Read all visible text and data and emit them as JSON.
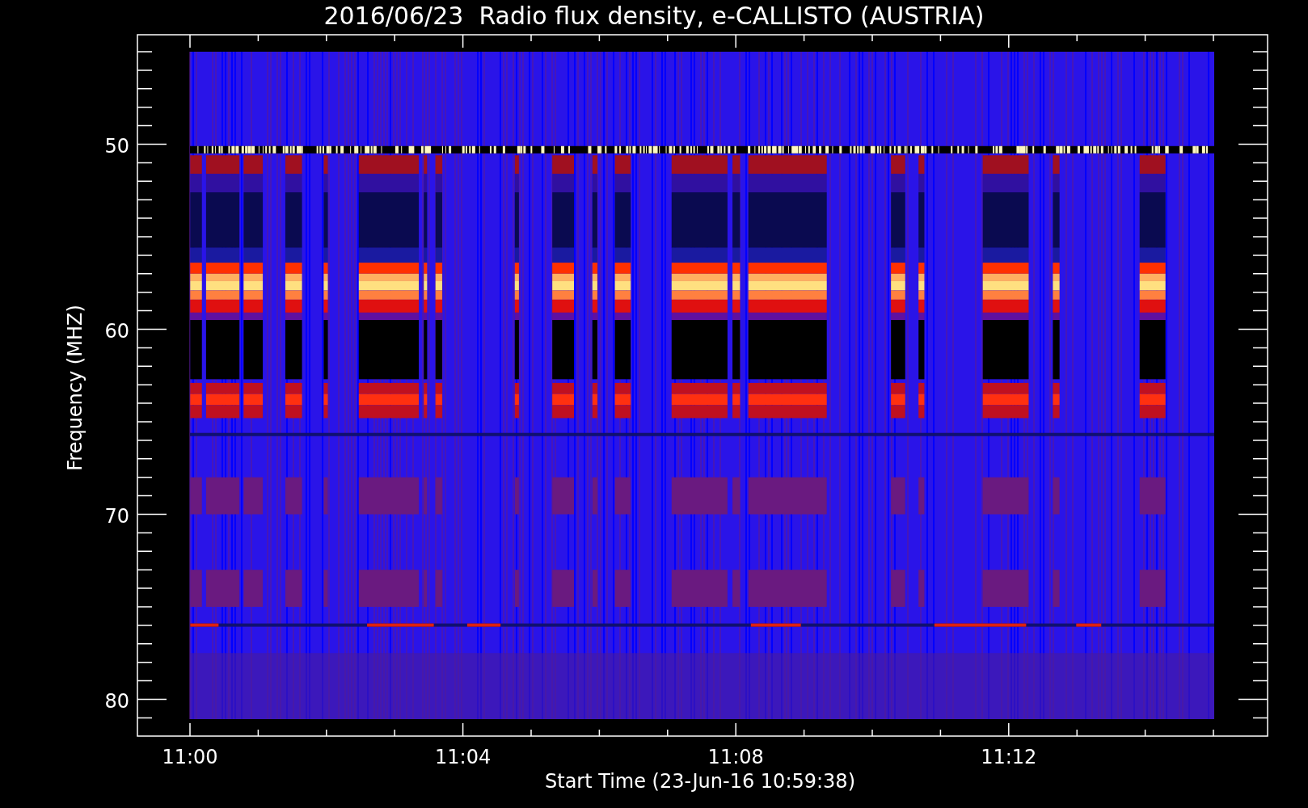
{
  "title": "2016/06/23  Radio flux density, e-CALLISTO (AUSTRIA)",
  "y_axis": {
    "label": "Frequency (MHZ)",
    "tick_labels": [
      "50",
      "60",
      "70",
      "80"
    ]
  },
  "x_axis": {
    "label": "Start Time (23-Jun-16 10:59:38)",
    "tick_labels": [
      "11:00",
      "11:04",
      "11:08",
      "11:12"
    ]
  }
}
